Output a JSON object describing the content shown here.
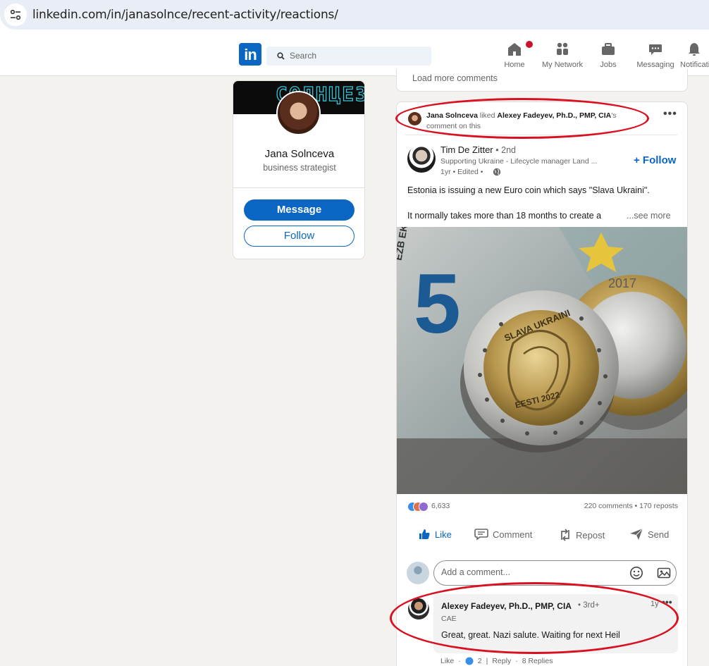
{
  "browser": {
    "url": "linkedin.com/in/janasolnce/recent-activity/reactions/"
  },
  "nav": {
    "logo": "in",
    "search_placeholder": "Search",
    "items": [
      {
        "label": "Home",
        "icon": "home-icon"
      },
      {
        "label": "My Network",
        "icon": "network-icon"
      },
      {
        "label": "Jobs",
        "icon": "briefcase-icon"
      },
      {
        "label": "Messaging",
        "icon": "messaging-icon"
      },
      {
        "label": "Notificati",
        "icon": "bell-icon"
      }
    ]
  },
  "profile": {
    "banner_text": "СОЛНЦЕЗ",
    "name": "Jana Solnceva",
    "title": "business strategist",
    "message_label": "Message",
    "follow_label": "Follow"
  },
  "previous_post": {
    "load_more": "Load more comments"
  },
  "activity": {
    "actor": "Jana Solnceva",
    "verb": "liked",
    "target": "Alexey Fadeyev, Ph.D., PMP, CIA",
    "suffix_possessive": "'s",
    "suffix_line2": "comment on this"
  },
  "post": {
    "author": "Tim De Zitter",
    "degree": "• 2nd",
    "headline": "Supporting Ukraine - Lifecycle manager Land ...",
    "time": "1yr • Edited •",
    "follow_label": "+ Follow",
    "text_line1": "Estonia is issuing a new Euro coin which says \"Slava Ukraini\".",
    "text_line2": "It normally takes more than 18 months to create a",
    "see_more": "...see more",
    "coin_text_top": "SLAVA UKRAINI",
    "coin_text_bottom": "EESTI 2022",
    "coin2_year": "2017",
    "banknote_digit": "5",
    "banknote_letters": "EZB EKT",
    "reaction_count": "6,633",
    "comments_reposts": "220 comments • 170 reposts",
    "actions": {
      "like": "Like",
      "comment": "Comment",
      "repost": "Repost",
      "send": "Send"
    },
    "comment_placeholder": "Add a comment..."
  },
  "comment": {
    "name": "Alexey Fadeyev, Ph.D., PMP, CIA",
    "degree": "• 3rd+",
    "time": "1y",
    "headline": "CAE",
    "body": "Great, great. Nazi salute. Waiting for next Heil",
    "like": "Like",
    "like_count": "2",
    "reply": "Reply",
    "replies": "8 Replies"
  },
  "colors": {
    "brand": "#0a66c2",
    "annotation": "#d9101f",
    "page_bg": "#f4f2ee"
  }
}
